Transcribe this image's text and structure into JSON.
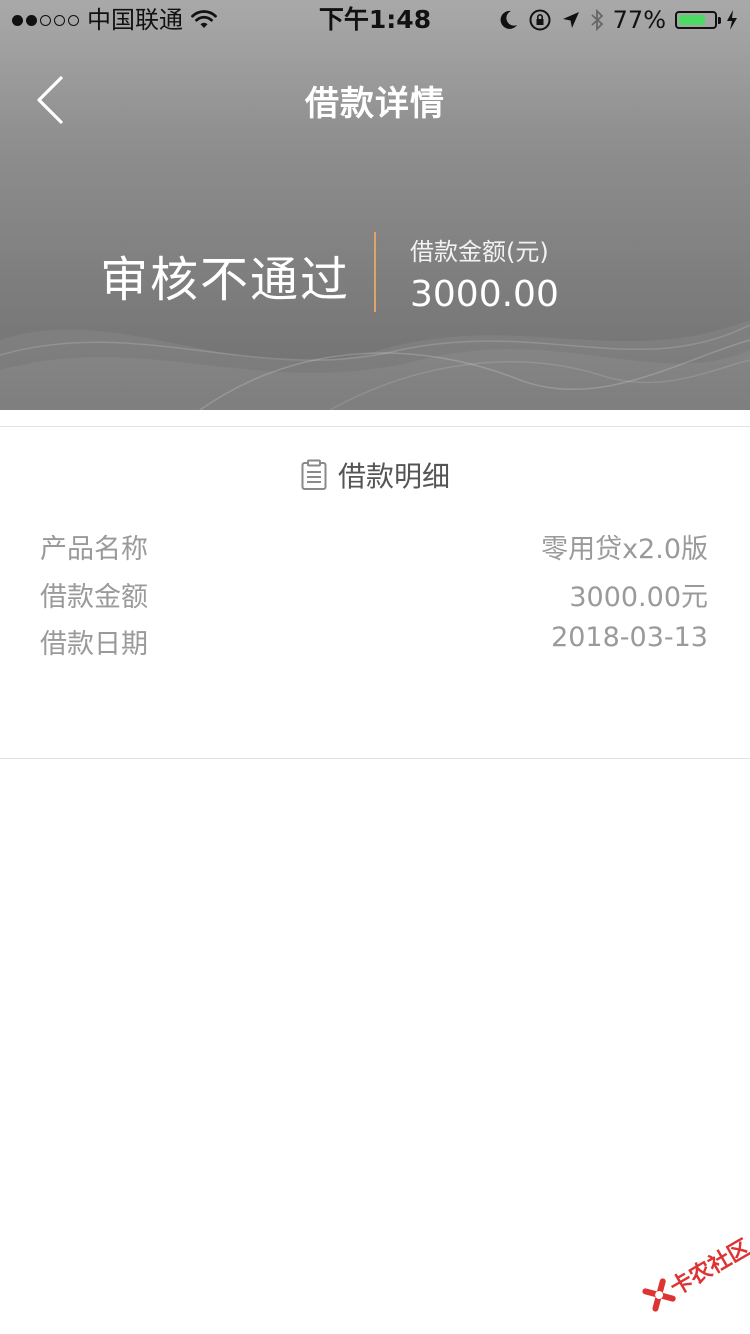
{
  "status_bar": {
    "carrier": "中国联通",
    "time": "下午1:48",
    "battery_percent_text": "77%",
    "battery_level": 0.77,
    "signal_bars_filled": 2,
    "signal_bars_total": 5
  },
  "nav": {
    "title": "借款详情",
    "back_icon": "chevron-left-icon"
  },
  "summary": {
    "status": "审核不通过",
    "amount_label": "借款金额(元)",
    "amount_value": "3000.00"
  },
  "details": {
    "section_title": "借款明细",
    "section_icon": "clipboard-icon",
    "rows": [
      {
        "label": "产品名称",
        "value": "零用贷x2.0版"
      },
      {
        "label": "借款金额",
        "value": "3000.00元"
      },
      {
        "label": "借款日期",
        "value": "2018-03-13"
      }
    ]
  },
  "watermark": {
    "text": "卡农社区"
  },
  "colors": {
    "accent_divider": "#e0a36a",
    "battery_fill": "#4cd964",
    "header_gradient_top": "#a9a9a9",
    "header_gradient_bottom": "#6f6f6f",
    "detail_text": "#9a9a9a"
  }
}
